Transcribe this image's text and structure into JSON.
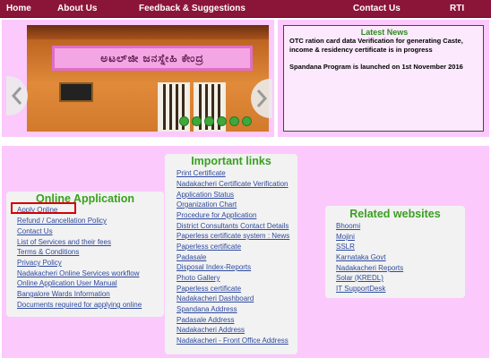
{
  "nav": {
    "home": "Home",
    "about": "About Us",
    "feedback": "Feedback & Suggestions",
    "contact": "Contact Us",
    "rti": "RTI"
  },
  "slider": {
    "sign_text": "ಅಟಲ್‌ಜೀ ಜನಸ್ನೇಹಿ ಕೇಂದ್ರ",
    "dot_count": 6
  },
  "news": {
    "title": "Latest News",
    "items": [
      "OTC ration card data Verification for generating Caste, income & residency certificate is in progress",
      "Spandana Program is launched on 1st November 2016"
    ]
  },
  "online_application": {
    "title": "Online Application",
    "links": [
      "Apply Online",
      "Refund / Cancellation Policy",
      "Contact Us",
      "List of Services and their fees",
      "Terms & Conditions",
      "Privacy Policy",
      "Nadakacheri Online Services workflow",
      "Online Application User Manual",
      "Bangalore Wards Information",
      "Documents required for applying online"
    ]
  },
  "important_links": {
    "title": "Important links",
    "links": [
      "Print Certificate",
      "Nadakacheri Certificate Verification",
      "Application Status",
      "Organization Chart",
      "Procedure for Application",
      "District Consultants Contact Details",
      "Paperless certificate system : News",
      "Paperless certificate",
      "Padasale",
      "Disposal Index-Reports",
      "Photo Gallery",
      "Paperless certificate",
      "Nadakacheri Dashboard",
      "Spandana Address",
      "Padasale Address",
      "Nadakacheri Address",
      "Nadakacheri - Front Office Address"
    ]
  },
  "related_websites": {
    "title": "Related websites",
    "links": [
      "Bhoomi",
      "Mojini",
      "SSLR",
      "Karnataka Govt",
      "Nadakacheri Reports",
      "Solar (KREDL)",
      "IT SupportDesk"
    ]
  },
  "colors": {
    "nav_bg": "#8b1538",
    "panel_pink": "#fcc9fc",
    "heading_green": "#3aa020",
    "link_blue": "#2e4a9e",
    "highlight_red": "#d40000"
  }
}
